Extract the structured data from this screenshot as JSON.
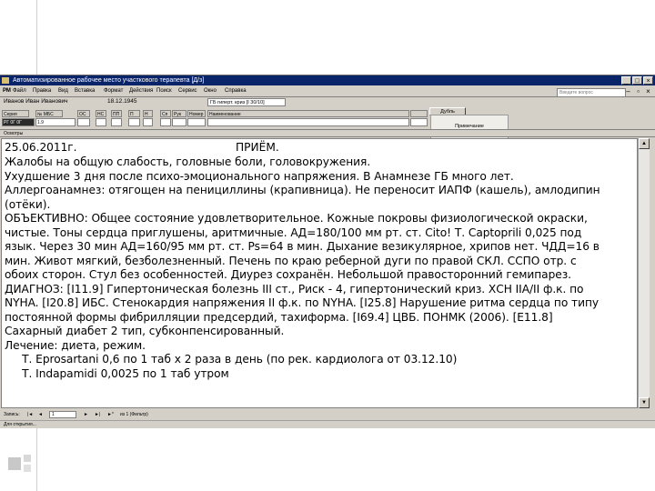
{
  "window": {
    "title": "Автоматизированное рабочее место участкового терапевта  [Д/з]",
    "min": "_",
    "max": "□",
    "close": "×"
  },
  "menu": {
    "items": [
      "Файл",
      "Правка",
      "Вид",
      "Вставка",
      "Формат",
      "Действия",
      "Поиск",
      "Сервис",
      "Окно",
      "Справка"
    ],
    "prefix": "РМ",
    "search_placeholder": "Введите вопрос"
  },
  "patient": {
    "name": "Иванов Иван Иванович",
    "dob": "18.12.1945",
    "diagnosis_field": "ГБ гиперт. криз [І 30/10]",
    "save_button": "Дубль"
  },
  "grid": {
    "headers": [
      "Серия",
      "№ МБС",
      "ОС",
      "НС",
      "ПП",
      "П",
      "Н",
      "Сп",
      "Рук",
      "Номер",
      "Наименование",
      "",
      "Пец"
    ],
    "values": [
      "РГ 0Г 0Г",
      "1.9",
      "",
      "",
      "",
      "",
      "",
      "",
      "",
      "",
      "",
      "",
      ""
    ]
  },
  "dropdown": {
    "item": "Примечание"
  },
  "section_label": "Осмотры",
  "document": {
    "date": "25.06.2011г.",
    "heading": "ПРИЁМ.",
    "lines": [
      "Жалобы на общую слабость, головные боли, головокружения.",
      "Ухудшение 3 дня после психо-эмоционального напряжения. В Анамнезе ГБ много лет.",
      "Аллергоанамнез: отягощен на пенициллины (крапивница). Не переносит ИАПФ (кашель), амлодипин",
      "(отёки).",
      "ОБЪЕКТИВНО: Общее состояние удовлетворительное. Кожные покровы физиологической окраски,",
      "чистые. Тоны сердца приглушены, аритмичные. АД=180/100 мм рт. ст. Cito! Т. Captoprili 0,025 под",
      "язык. Через 30 мин АД=160/95 мм рт. ст. Ps=64 в мин. Дыхание везикулярное, хрипов нет. ЧДД=16 в",
      "мин. Живот мягкий, безболезненный. Печень по краю реберной дуги по правой СКЛ. ССПО отр. с",
      "обоих сторон. Стул без особенностей. Диурез сохранён. Небольшой правосторонний гемипарез.",
      "ДИАГНОЗ: [I11.9] Гипертоническая болезнь III ст., Риск - 4, гипертонический криз. ХСН IIА/II ф.к. по",
      "NYHA. [I20.8] ИБС. Стенокардия напряжения II  ф.к. по NYHA. [I25.8] Нарушение ритма сердца по типу",
      "постоянной формы фибрилляции предсердий, тахиформа. [I69.4] ЦВБ. ПОНМК (2006). [E11.8]",
      "Сахарный диабет 2 тип, субконпенсированный.",
      "Лечение: диета, режим.",
      "     Т. Eprosartani 0,6 по 1 таб х 2 раза в день (по рек. кардиолога от 03.12.10)",
      "     Т. Indapamidi 0,0025 по 1 таб утром"
    ]
  },
  "navigation": {
    "record_label": "Запись:",
    "first": "|◄",
    "prev": "◄",
    "next": "►",
    "last": "►|",
    "new": "►*",
    "counter": "1",
    "of_text": "из 1 (Фильтр)"
  },
  "status": "Для открытия..."
}
